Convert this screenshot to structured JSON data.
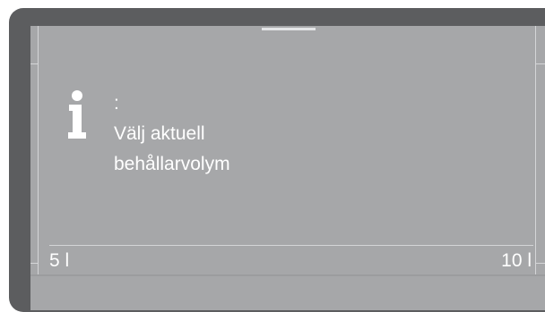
{
  "message": {
    "colon": ":",
    "line1": "Välj aktuell",
    "line2": "behållarvolym"
  },
  "scale": {
    "min_label": "5 l",
    "max_label": "10 l"
  },
  "colors": {
    "screen": "#a6a7a9",
    "bezel": "#5c5d5f",
    "text": "#ffffff"
  },
  "icons": {
    "info": "info-icon"
  }
}
